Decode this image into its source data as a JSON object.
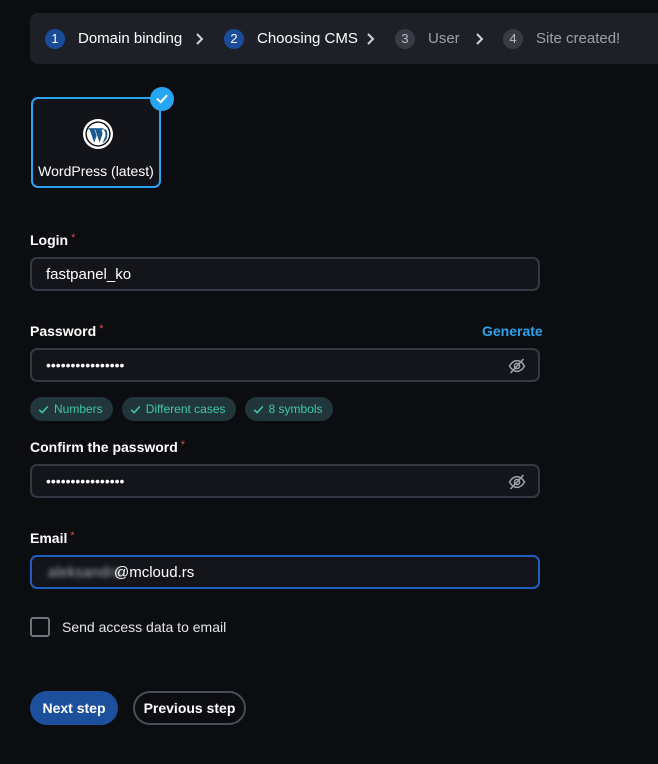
{
  "stepper": {
    "steps": [
      {
        "num": "1",
        "label": "Domain binding",
        "state": "active"
      },
      {
        "num": "2",
        "label": "Choosing CMS",
        "state": "active"
      },
      {
        "num": "3",
        "label": "User",
        "state": "inactive"
      },
      {
        "num": "4",
        "label": "Site created!",
        "state": "inactive"
      }
    ]
  },
  "cms": {
    "name": "WordPress (latest)",
    "selected": true,
    "icon": "wordpress-icon"
  },
  "login": {
    "label": "Login",
    "required": "*",
    "value": "fastpanel_ko"
  },
  "password": {
    "label": "Password",
    "required": "*",
    "value": "••••••••••••••••",
    "generate_label": "Generate"
  },
  "requirements": [
    "Numbers",
    "Different cases",
    "8 symbols"
  ],
  "confirm": {
    "label": "Confirm the password",
    "required": "*",
    "value": "••••••••••••••••"
  },
  "email": {
    "label": "Email",
    "required": "*",
    "user_blurred": "aleksandra",
    "domain": "@mcloud.rs"
  },
  "send_access": {
    "label": "Send access data to email",
    "checked": false
  },
  "actions": {
    "next_label": "Next step",
    "prev_label": "Previous step"
  },
  "colors": {
    "accent": "#2aa3f0",
    "primary_button": "#1c4f9c",
    "success_text": "#3ec9a4",
    "required": "#e0494b"
  }
}
